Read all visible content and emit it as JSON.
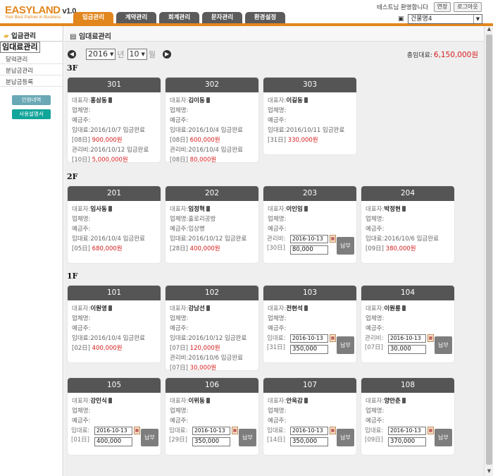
{
  "app": {
    "logo": "EASYLAND",
    "version": "v1.0",
    "slogan": "Your Best Partner in Business"
  },
  "tabs": [
    "입금관리",
    "계약관리",
    "회계관리",
    "문자관리",
    "환경설정"
  ],
  "header": {
    "welcome": "테스트님 환영합니다",
    "extend": "연장",
    "logout": "로그아웃",
    "building": "건물명4"
  },
  "sidebar": {
    "title": "입금관리",
    "items": [
      "임대료관리",
      "달력관리",
      "분납금관리",
      "분납금등록"
    ],
    "btn1": "민원내역",
    "btn2": "사용설명서"
  },
  "page": {
    "title": "임대료관리",
    "year": "2016",
    "year_unit": "년",
    "month": "10",
    "month_unit": "월",
    "total_label": "총임대료:",
    "total_value": "6,150,000원"
  },
  "labels": {
    "rep": "대표자:",
    "company": "업체명:",
    "depositor": "예금주:",
    "rent": "임대료:",
    "mgmt": "관리비:",
    "pay": "납부"
  },
  "floors": [
    {
      "name": "3F",
      "units": [
        {
          "no": "301",
          "rep": "홍삼동",
          "company": "",
          "depositor": "",
          "lines": [
            {
              "lbl": "임대료:",
              "text": "2016/10/7 입금완료",
              "sub": "[08日]",
              "amt": "900,000원"
            },
            {
              "lbl": "관리비:",
              "text": "2016/10/12 입금완료",
              "sub": "[10日]",
              "amt": "5,000,000원"
            }
          ]
        },
        {
          "no": "302",
          "rep": "김이동",
          "company": "",
          "depositor": "",
          "lines": [
            {
              "lbl": "임대료:",
              "text": "2016/10/4 입금완료",
              "sub": "[08日]",
              "amt": "600,000원"
            },
            {
              "lbl": "관리비:",
              "text": "2016/10/4 입금완료",
              "sub": "[08日]",
              "amt": "80,000원"
            }
          ]
        },
        {
          "no": "303",
          "rep": "이길동",
          "company": "",
          "depositor": "",
          "lines": [
            {
              "lbl": "임대료:",
              "text": "2016/10/11 입금완료",
              "sub": "[31日]",
              "amt": "330,000원"
            }
          ]
        }
      ]
    },
    {
      "name": "2F",
      "units": [
        {
          "no": "201",
          "rep": "임사동",
          "company": "",
          "depositor": "",
          "lines": [
            {
              "lbl": "임대료:",
              "text": "2016/10/4 입금완료",
              "sub": "[05日]",
              "amt": "680,000원"
            }
          ]
        },
        {
          "no": "202",
          "rep": "임정혁",
          "company": "홀로리공방",
          "depositor": "임상병",
          "lines": [
            {
              "lbl": "임대료:",
              "text": "2016/10/12 입금완료",
              "sub": "[28日]",
              "amt": "400,000원"
            }
          ]
        },
        {
          "no": "203",
          "rep": "이인임",
          "company": "",
          "depositor": "",
          "pay": {
            "lbl": "관리비:",
            "sub": "[30日]",
            "date": "2016-10-13",
            "amount": "80,000"
          }
        },
        {
          "no": "204",
          "rep": "박정현",
          "company": "",
          "depositor": "",
          "lines": [
            {
              "lbl": "임대료:",
              "text": "2016/10/6 입금완료",
              "sub": "[09日]",
              "amt": "380,000원"
            }
          ]
        }
      ]
    },
    {
      "name": "1F",
      "units": [
        {
          "no": "101",
          "rep": "이원영",
          "company": "",
          "depositor": "",
          "lines": [
            {
              "lbl": "임대료:",
              "text": "2016/10/4 입금완료",
              "sub": "[02日]",
              "amt": "400,000원"
            }
          ]
        },
        {
          "no": "102",
          "rep": "강남선",
          "company": "",
          "depositor": "",
          "lines": [
            {
              "lbl": "임대료:",
              "text": "2016/10/12 입금완료",
              "sub": "[07日]",
              "amt": "120,000원"
            },
            {
              "lbl": "관리비:",
              "text": "2016/10/6 입금완료",
              "sub": "[07日]",
              "amt": "30,000원"
            }
          ]
        },
        {
          "no": "103",
          "rep": "전현석",
          "company": "",
          "depositor": "",
          "pay": {
            "lbl": "임대료:",
            "sub": "[31日]",
            "date": "2016-10-13",
            "amount": "350,000"
          }
        },
        {
          "no": "104",
          "rep": "이원룡",
          "company": "",
          "depositor": "",
          "pay": {
            "lbl": "관리비:",
            "sub": "[07日]",
            "date": "2016-10-13",
            "amount": "30,000"
          }
        },
        {
          "no": "105",
          "rep": "강민식",
          "company": "",
          "depositor": "",
          "pay": {
            "lbl": "임대료:",
            "sub": "[01日]",
            "date": "2016-10-13",
            "amount": "400,000"
          }
        },
        {
          "no": "106",
          "rep": "이위동",
          "company": "",
          "depositor": "",
          "pay": {
            "lbl": "임대료:",
            "sub": "[29日]",
            "date": "2016-10-13",
            "amount": "350,000"
          }
        },
        {
          "no": "107",
          "rep": "안옥감",
          "company": "",
          "depositor": "",
          "pay": {
            "lbl": "임대료:",
            "sub": "[14日]",
            "date": "2016-10-13",
            "amount": "350,000"
          }
        },
        {
          "no": "108",
          "rep": "양만춘",
          "company": "",
          "depositor": "",
          "pay": {
            "lbl": "임대료:",
            "sub": "[09日]",
            "date": "2016-10-13",
            "amount": "370,000"
          }
        }
      ]
    }
  ]
}
